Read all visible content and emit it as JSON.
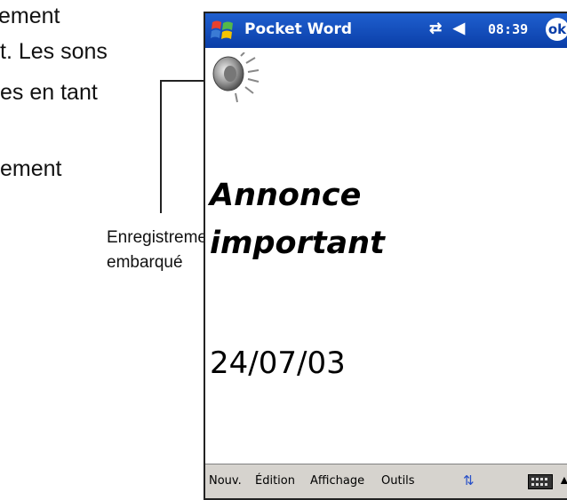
{
  "manual_text": {
    "line1": "ement",
    "line2": "t. Les sons",
    "line3": "es en tant",
    "line4": "ement"
  },
  "callout": {
    "line1": "Enregistrement",
    "line2": "embarqué"
  },
  "device": {
    "title_bar": {
      "app_title": "Pocket Word",
      "time": "08:39",
      "ok_label": "ok"
    },
    "document": {
      "title_line1": "Annonce",
      "title_line2": "important",
      "date": "24/07/03"
    },
    "menu_bar": {
      "items": [
        "Nouv.",
        "Édition",
        "Affichage",
        "Outils"
      ]
    }
  },
  "colors": {
    "title_bar": "#0a3ea8",
    "menu_bar": "#d6d3ce"
  }
}
